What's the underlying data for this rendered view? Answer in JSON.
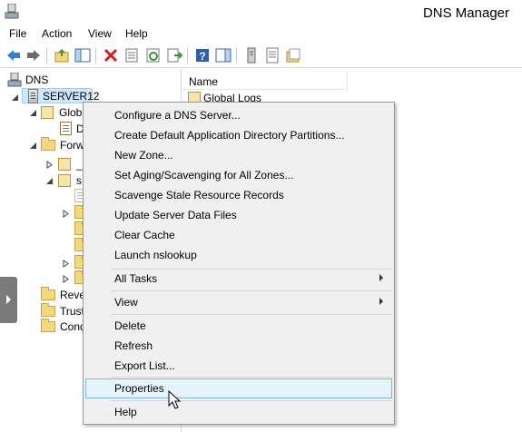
{
  "window": {
    "title": "DNS Manager"
  },
  "menubar": {
    "items": [
      "File",
      "Action",
      "View",
      "Help"
    ]
  },
  "toolbar": {
    "buttons": [
      "back-arrow-icon",
      "forward-arrow-icon",
      "up-folder-icon",
      "show-hide-tree-icon",
      "delete-icon",
      "properties-icon",
      "refresh-icon",
      "export-icon",
      "help-icon",
      "action-pane-icon",
      "server-icon",
      "log-icon",
      "folder-icon"
    ]
  },
  "tree": {
    "root": "DNS",
    "server": "SERVER12",
    "global_logs_trunc": "Glob",
    "dns_events_trunc": "D",
    "forward_zones_trunc": "Forw",
    "zone_a_trunc": "_",
    "zone_b_trunc": "s",
    "reverse_zones_trunc": "Reve",
    "trust_points_trunc": "Trust",
    "conditional_fwd_trunc": "Cond"
  },
  "details": {
    "column_name": "Name",
    "rows": [
      "Global Logs"
    ]
  },
  "context_menu": {
    "group1": [
      "Configure a DNS Server...",
      "Create Default Application Directory Partitions...",
      "New Zone...",
      "Set Aging/Scavenging for All Zones...",
      "Scavenge Stale Resource Records",
      "Update Server Data Files",
      "Clear Cache",
      "Launch nslookup"
    ],
    "all_tasks": "All Tasks",
    "view": "View",
    "group3": [
      "Delete",
      "Refresh",
      "Export List..."
    ],
    "properties": "Properties",
    "help": "Help",
    "hovered_item": "Properties"
  },
  "colors": {
    "selection_bg": "#cce8ff",
    "menu_bg": "#f0f0f0",
    "hover_border": "#7eb4ea",
    "folder": "#f4d77f"
  }
}
